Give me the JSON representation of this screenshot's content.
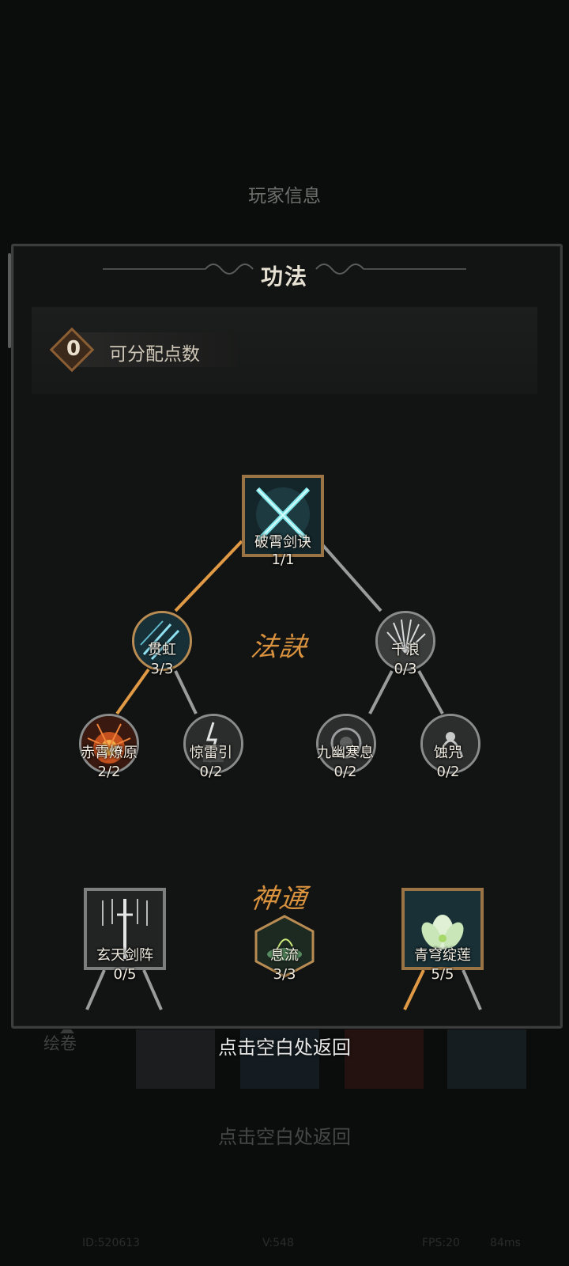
{
  "background": {
    "title": "玩家信息",
    "tab_label": "绘卷",
    "hint": "点击空白处返回",
    "stats": [
      "ID:520613",
      "V:548",
      "FPS:20",
      "84ms"
    ]
  },
  "panel": {
    "title": "功法",
    "points": {
      "value": "0",
      "label": "可分配点数"
    },
    "sections": {
      "fajue": "法訣",
      "shentong": "神通"
    },
    "nodes": {
      "root": {
        "name": "破霄剑诀",
        "level": "1/1"
      },
      "guanhong": {
        "name": "贯虹",
        "level": "3/3"
      },
      "qianlang": {
        "name": "千浪",
        "level": "0/3"
      },
      "chixiao": {
        "name": "赤霄燎原",
        "level": "2/2"
      },
      "jingleiyin": {
        "name": "惊雷引",
        "level": "0/2"
      },
      "jiuyou": {
        "name": "九幽寒息",
        "level": "0/2"
      },
      "shizhou": {
        "name": "蚀咒",
        "level": "0/2"
      },
      "xuantian": {
        "name": "玄天剑阵",
        "level": "0/5"
      },
      "xiliu": {
        "name": "息流",
        "level": "3/3"
      },
      "qingqiong": {
        "name": "青穹绽莲",
        "level": "5/5"
      }
    }
  },
  "hint": "点击空白处返回",
  "colors": {
    "active_line": "#e09a45",
    "inactive_line": "#9a9c9b",
    "accent": "#d9923e"
  }
}
